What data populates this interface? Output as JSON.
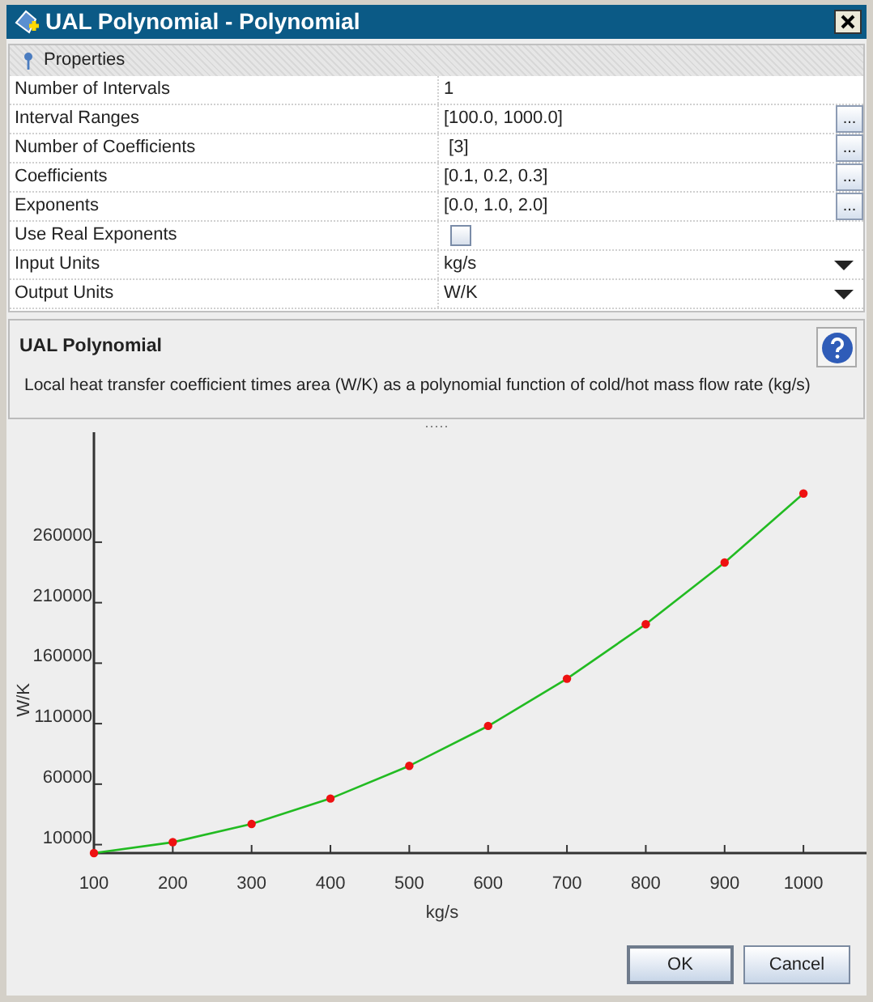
{
  "window": {
    "title": "UAL Polynomial - Polynomial"
  },
  "properties": {
    "header": "Properties",
    "rows": [
      {
        "label": "Number of Intervals",
        "kind": "text",
        "value": "1"
      },
      {
        "label": "Interval Ranges",
        "kind": "ellipsis",
        "value": "[100.0, 1000.0]",
        "button": "..."
      },
      {
        "label": "Number of Coefficients",
        "kind": "ellipsis",
        "value": " [3]",
        "button": "..."
      },
      {
        "label": "Coefficients",
        "kind": "ellipsis",
        "value": "[0.1, 0.2, 0.3]",
        "button": "..."
      },
      {
        "label": "Exponents",
        "kind": "ellipsis",
        "value": "[0.0, 1.0, 2.0]",
        "button": "..."
      },
      {
        "label": "Use Real Exponents",
        "kind": "checkbox",
        "checked": false
      },
      {
        "label": "Input Units",
        "kind": "dropdown",
        "value": "kg/s"
      },
      {
        "label": "Output Units",
        "kind": "dropdown",
        "value": "W/K"
      }
    ]
  },
  "description": {
    "title": "UAL Polynomial",
    "text": "Local heat transfer coefficient times area (W/K) as a polynomial function of cold/hot mass flow rate (kg/s)"
  },
  "splitter": "·····",
  "chart_data": {
    "type": "line",
    "xlabel": "kg/s",
    "ylabel": "W/K",
    "x": [
      100,
      200,
      300,
      400,
      500,
      600,
      700,
      800,
      900,
      1000
    ],
    "series": [
      {
        "color": "#22bb22",
        "marker": "circle",
        "values": [
          3020,
          12040,
          27060,
          48080,
          75100,
          108120,
          147140,
          192160,
          243180,
          300200
        ]
      }
    ],
    "xlim": [
      100,
      1080
    ],
    "ylim": [
      3020,
      350909
    ],
    "xticks": [
      100,
      200,
      300,
      400,
      500,
      600,
      700,
      800,
      900,
      1000
    ],
    "yticks": [
      10000,
      60000,
      110000,
      160000,
      210000,
      260000
    ]
  },
  "buttons": [
    {
      "label": "OK",
      "default": true
    },
    {
      "label": "Cancel",
      "default": false
    }
  ]
}
